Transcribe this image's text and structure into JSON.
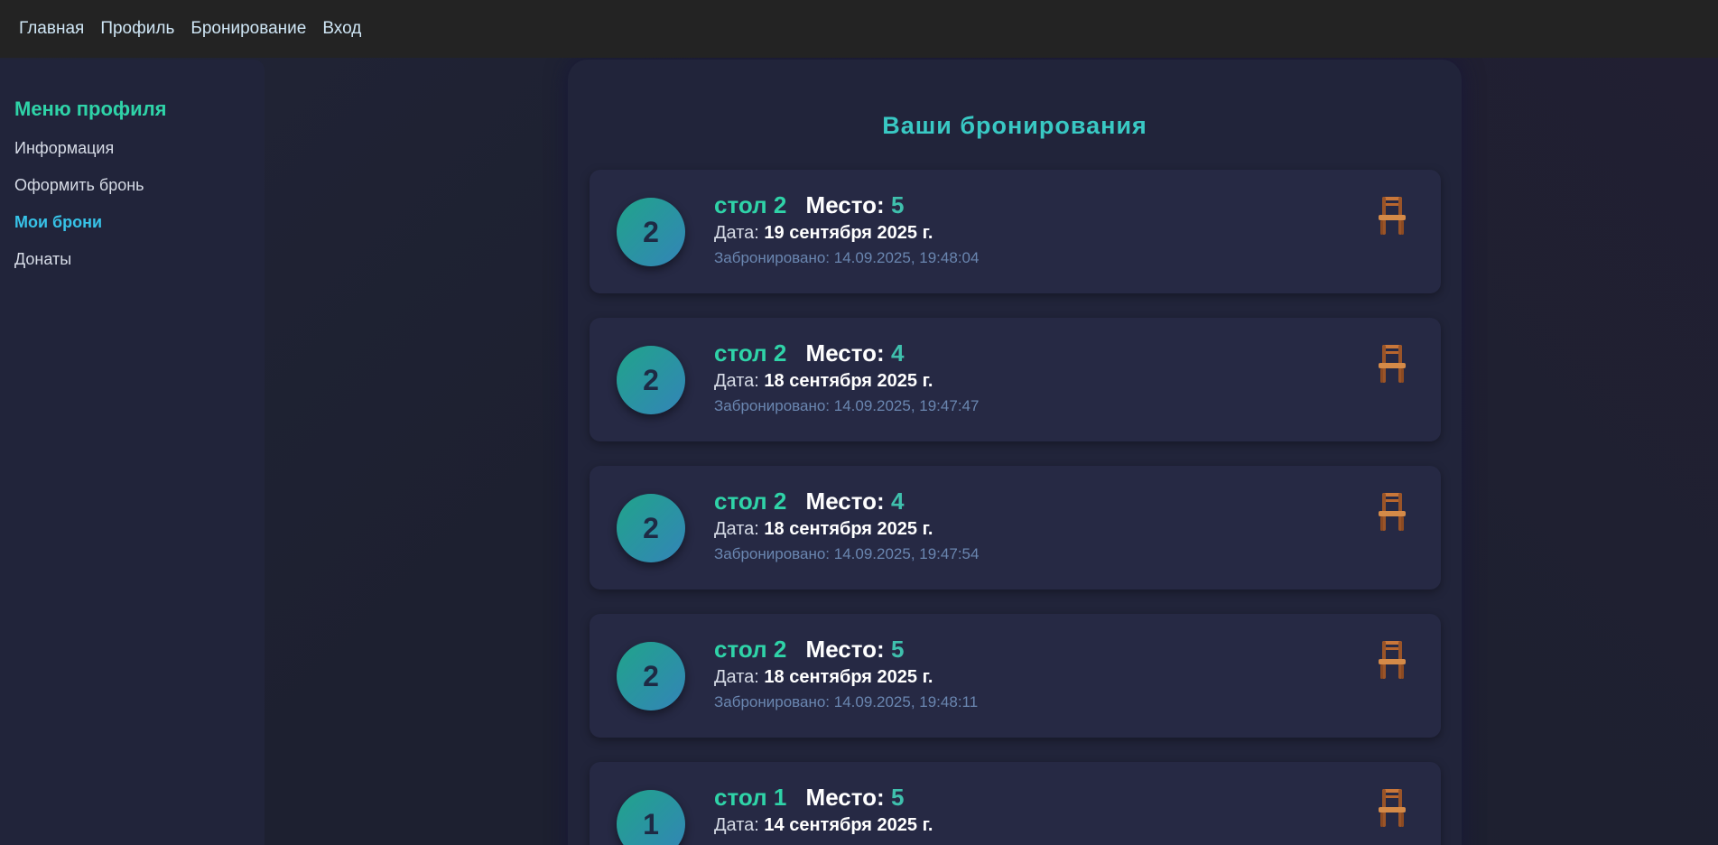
{
  "nav": {
    "items": [
      "Главная",
      "Профиль",
      "Бронирование",
      "Вход"
    ]
  },
  "sidebar": {
    "title": "Меню профиля",
    "items": [
      {
        "label": "Информация",
        "active": false
      },
      {
        "label": "Оформить бронь",
        "active": false
      },
      {
        "label": "Мои брони",
        "active": true
      },
      {
        "label": "Донаты",
        "active": false
      }
    ]
  },
  "main": {
    "title": "Ваши бронирования",
    "seat_label": "Место:",
    "date_label": "Дата:",
    "bookings": [
      {
        "badge": "2",
        "table": "стол 2",
        "seat": "5",
        "date": "19 сентября 2025 г.",
        "booked": "Забронировано: 14.09.2025, 19:48:04",
        "icon": "chair-icon"
      },
      {
        "badge": "2",
        "table": "стол 2",
        "seat": "4",
        "date": "18 сентября 2025 г.",
        "booked": "Забронировано: 14.09.2025, 19:47:47",
        "icon": "chair-icon"
      },
      {
        "badge": "2",
        "table": "стол 2",
        "seat": "4",
        "date": "18 сентября 2025 г.",
        "booked": "Забронировано: 14.09.2025, 19:47:54",
        "icon": "chair-icon"
      },
      {
        "badge": "2",
        "table": "стол 2",
        "seat": "5",
        "date": "18 сентября 2025 г.",
        "booked": "Забронировано: 14.09.2025, 19:48:11",
        "icon": "chair-icon"
      },
      {
        "badge": "1",
        "table": "стол 1",
        "seat": "5",
        "date": "14 сентября 2025 г.",
        "booked": "",
        "icon": "chair-icon"
      }
    ]
  },
  "colors": {
    "accent": "#2fd3a8",
    "active_link": "#37c3e8",
    "title": "#39c9c4",
    "muted": "#6a86b0"
  }
}
